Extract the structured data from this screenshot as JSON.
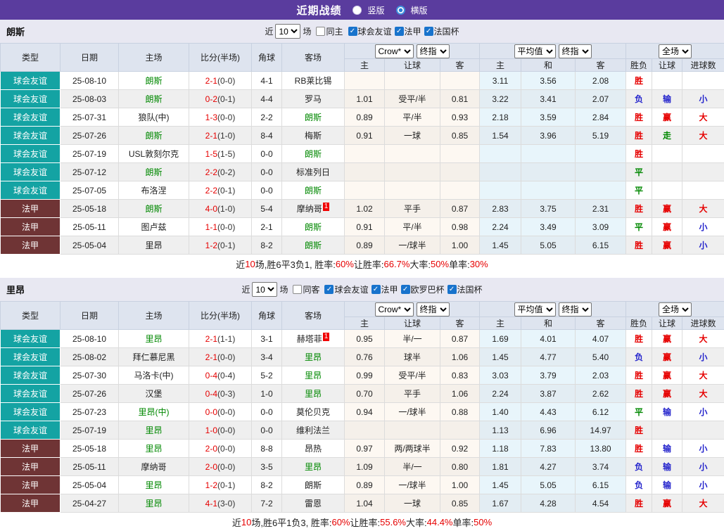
{
  "topbar": {
    "title": "近期战绩",
    "radios": [
      {
        "label": "竖版",
        "checked": false
      },
      {
        "label": "横版",
        "checked": true
      }
    ]
  },
  "table_header": {
    "cols": [
      "类型",
      "日期",
      "主场",
      "比分(半场)",
      "角球",
      "客场"
    ],
    "group1_selects": [
      "Crow*",
      "终指"
    ],
    "group2_selects": [
      "平均值",
      "终指"
    ],
    "group3_selects": [
      "全场"
    ],
    "sub_cols": [
      "主",
      "让球",
      "客",
      "主",
      "和",
      "客",
      "胜负",
      "让球",
      "进球数"
    ]
  },
  "colors": {
    "red": "#E60000",
    "green": "#008800",
    "blue": "#2424CC",
    "teal": "#14A3A3",
    "maroon": "#6F3435",
    "purple": "#5A3C9E"
  },
  "sections": [
    {
      "team": "朗斯",
      "filter": {
        "prefix": "近",
        "matches": "10",
        "suffix": "场",
        "same_label": "同主",
        "same_checked": false,
        "leagues": [
          {
            "label": "球会友谊",
            "checked": true
          },
          {
            "label": "法甲",
            "checked": true
          },
          {
            "label": "法国杯",
            "checked": true
          }
        ]
      },
      "rows": [
        {
          "league": "球会友谊",
          "kind": "f",
          "date": "25-08-10",
          "home": "朗斯",
          "home_green": 1,
          "home_badge": "",
          "score": "2-1",
          "half": "(0-0)",
          "corners": "4-1",
          "away": "RB莱比锡",
          "away_green": 0,
          "away_badge": "",
          "odds_home": "",
          "line": "",
          "odds_away": "",
          "avg_home": "3.11",
          "avg_draw": "3.56",
          "avg_away": "2.08",
          "wdl": [
            "胜",
            "r"
          ],
          "handicap_res": [
            "",
            ""
          ],
          "goals_res": [
            "",
            ""
          ]
        },
        {
          "league": "球会友谊",
          "kind": "f",
          "date": "25-08-03",
          "home": "朗斯",
          "home_green": 1,
          "home_badge": "",
          "score": "0-2",
          "half": "(0-1)",
          "corners": "4-4",
          "away": "罗马",
          "away_green": 0,
          "away_badge": "",
          "odds_home": "1.01",
          "line": "受平/半",
          "odds_away": "0.81",
          "avg_home": "3.22",
          "avg_draw": "3.41",
          "avg_away": "2.07",
          "wdl": [
            "负",
            "b"
          ],
          "handicap_res": [
            "输",
            "b"
          ],
          "goals_res": [
            "小",
            "b"
          ]
        },
        {
          "league": "球会友谊",
          "kind": "f",
          "date": "25-07-31",
          "home": "狼队(中)",
          "home_green": 0,
          "home_badge": "",
          "score": "1-3",
          "half": "(0-0)",
          "corners": "2-2",
          "away": "朗斯",
          "away_green": 1,
          "away_badge": "",
          "odds_home": "0.89",
          "line": "平/半",
          "odds_away": "0.93",
          "avg_home": "2.18",
          "avg_draw": "3.59",
          "avg_away": "2.84",
          "wdl": [
            "胜",
            "r"
          ],
          "handicap_res": [
            "赢",
            "r"
          ],
          "goals_res": [
            "大",
            "r"
          ]
        },
        {
          "league": "球会友谊",
          "kind": "f",
          "date": "25-07-26",
          "home": "朗斯",
          "home_green": 1,
          "home_badge": "",
          "score": "2-1",
          "half": "(1-0)",
          "corners": "8-4",
          "away": "梅斯",
          "away_green": 0,
          "away_badge": "",
          "odds_home": "0.91",
          "line": "一球",
          "odds_away": "0.85",
          "avg_home": "1.54",
          "avg_draw": "3.96",
          "avg_away": "5.19",
          "wdl": [
            "胜",
            "r"
          ],
          "handicap_res": [
            "走",
            "g"
          ],
          "goals_res": [
            "大",
            "r"
          ]
        },
        {
          "league": "球会友谊",
          "kind": "f",
          "date": "25-07-19",
          "home": "USL敦刻尔克",
          "home_green": 0,
          "home_badge": "",
          "score": "1-5",
          "half": "(1-5)",
          "corners": "0-0",
          "away": "朗斯",
          "away_green": 1,
          "away_badge": "",
          "odds_home": "",
          "line": "",
          "odds_away": "",
          "avg_home": "",
          "avg_draw": "",
          "avg_away": "",
          "wdl": [
            "胜",
            "r"
          ],
          "handicap_res": [
            "",
            ""
          ],
          "goals_res": [
            "",
            ""
          ]
        },
        {
          "league": "球会友谊",
          "kind": "f",
          "date": "25-07-12",
          "home": "朗斯",
          "home_green": 1,
          "home_badge": "",
          "score": "2-2",
          "half": "(0-2)",
          "corners": "0-0",
          "away": "标准列日",
          "away_green": 0,
          "away_badge": "",
          "odds_home": "",
          "line": "",
          "odds_away": "",
          "avg_home": "",
          "avg_draw": "",
          "avg_away": "",
          "wdl": [
            "平",
            "g"
          ],
          "handicap_res": [
            "",
            ""
          ],
          "goals_res": [
            "",
            ""
          ]
        },
        {
          "league": "球会友谊",
          "kind": "f",
          "date": "25-07-05",
          "home": "布洛涅",
          "home_green": 0,
          "home_badge": "",
          "score": "2-2",
          "half": "(0-1)",
          "corners": "0-0",
          "away": "朗斯",
          "away_green": 1,
          "away_badge": "",
          "odds_home": "",
          "line": "",
          "odds_away": "",
          "avg_home": "",
          "avg_draw": "",
          "avg_away": "",
          "wdl": [
            "平",
            "g"
          ],
          "handicap_res": [
            "",
            ""
          ],
          "goals_res": [
            "",
            ""
          ]
        },
        {
          "league": "法甲",
          "kind": "l",
          "date": "25-05-18",
          "home": "朗斯",
          "home_green": 1,
          "home_badge": "",
          "score": "4-0",
          "half": "(1-0)",
          "corners": "5-4",
          "away": "摩纳哥",
          "away_green": 0,
          "away_badge": "1",
          "odds_home": "1.02",
          "line": "平手",
          "odds_away": "0.87",
          "avg_home": "2.83",
          "avg_draw": "3.75",
          "avg_away": "2.31",
          "wdl": [
            "胜",
            "r"
          ],
          "handicap_res": [
            "赢",
            "r"
          ],
          "goals_res": [
            "大",
            "r"
          ]
        },
        {
          "league": "法甲",
          "kind": "l",
          "date": "25-05-11",
          "home": "图卢兹",
          "home_green": 0,
          "home_badge": "",
          "score": "1-1",
          "half": "(0-0)",
          "corners": "2-1",
          "away": "朗斯",
          "away_green": 1,
          "away_badge": "",
          "odds_home": "0.91",
          "line": "平/半",
          "odds_away": "0.98",
          "avg_home": "2.24",
          "avg_draw": "3.49",
          "avg_away": "3.09",
          "wdl": [
            "平",
            "g"
          ],
          "handicap_res": [
            "赢",
            "r"
          ],
          "goals_res": [
            "小",
            "b"
          ]
        },
        {
          "league": "法甲",
          "kind": "l",
          "date": "25-05-04",
          "home": "里昂",
          "home_green": 0,
          "home_badge": "",
          "score": "1-2",
          "half": "(0-1)",
          "corners": "8-2",
          "away": "朗斯",
          "away_green": 1,
          "away_badge": "",
          "odds_home": "0.89",
          "line": "一/球半",
          "odds_away": "1.00",
          "avg_home": "1.45",
          "avg_draw": "5.05",
          "avg_away": "6.15",
          "wdl": [
            "胜",
            "r"
          ],
          "handicap_res": [
            "赢",
            "r"
          ],
          "goals_res": [
            "小",
            "b"
          ]
        }
      ],
      "summary": [
        {
          "t": "近",
          "red": false
        },
        {
          "t": "10",
          "red": true
        },
        {
          "t": "场,胜6平3负1, 胜率:",
          "red": false
        },
        {
          "t": "60%",
          "red": true
        },
        {
          "t": " 让胜率:",
          "red": false
        },
        {
          "t": "66.7%",
          "red": true
        },
        {
          "t": " 大率:",
          "red": false
        },
        {
          "t": "50%",
          "red": true
        },
        {
          "t": " 单率:",
          "red": false
        },
        {
          "t": "30%",
          "red": true
        }
      ]
    },
    {
      "team": "里昂",
      "filter": {
        "prefix": "近",
        "matches": "10",
        "suffix": "场",
        "same_label": "同客",
        "same_checked": false,
        "leagues": [
          {
            "label": "球会友谊",
            "checked": true
          },
          {
            "label": "法甲",
            "checked": true
          },
          {
            "label": "欧罗巴杯",
            "checked": true
          },
          {
            "label": "法国杯",
            "checked": true
          }
        ]
      },
      "rows": [
        {
          "league": "球会友谊",
          "kind": "f",
          "date": "25-08-10",
          "home": "里昂",
          "home_green": 1,
          "home_badge": "",
          "score": "2-1",
          "half": "(1-1)",
          "corners": "3-1",
          "away": "赫塔菲",
          "away_green": 0,
          "away_badge": "1",
          "odds_home": "0.95",
          "line": "半/一",
          "odds_away": "0.87",
          "avg_home": "1.69",
          "avg_draw": "4.01",
          "avg_away": "4.07",
          "wdl": [
            "胜",
            "r"
          ],
          "handicap_res": [
            "赢",
            "r"
          ],
          "goals_res": [
            "大",
            "r"
          ]
        },
        {
          "league": "球会友谊",
          "kind": "f",
          "date": "25-08-02",
          "home": "拜仁慕尼黑",
          "home_green": 0,
          "home_badge": "",
          "score": "2-1",
          "half": "(0-0)",
          "corners": "3-4",
          "away": "里昂",
          "away_green": 1,
          "away_badge": "",
          "odds_home": "0.76",
          "line": "球半",
          "odds_away": "1.06",
          "avg_home": "1.45",
          "avg_draw": "4.77",
          "avg_away": "5.40",
          "wdl": [
            "负",
            "b"
          ],
          "handicap_res": [
            "赢",
            "r"
          ],
          "goals_res": [
            "小",
            "b"
          ]
        },
        {
          "league": "球会友谊",
          "kind": "f",
          "date": "25-07-30",
          "home": "马洛卡(中)",
          "home_green": 0,
          "home_badge": "",
          "score": "0-4",
          "half": "(0-4)",
          "corners": "5-2",
          "away": "里昂",
          "away_green": 1,
          "away_badge": "",
          "odds_home": "0.99",
          "line": "受平/半",
          "odds_away": "0.83",
          "avg_home": "3.03",
          "avg_draw": "3.79",
          "avg_away": "2.03",
          "wdl": [
            "胜",
            "r"
          ],
          "handicap_res": [
            "赢",
            "r"
          ],
          "goals_res": [
            "大",
            "r"
          ]
        },
        {
          "league": "球会友谊",
          "kind": "f",
          "date": "25-07-26",
          "home": "汉堡",
          "home_green": 0,
          "home_badge": "",
          "score": "0-4",
          "half": "(0-3)",
          "corners": "1-0",
          "away": "里昂",
          "away_green": 1,
          "away_badge": "",
          "odds_home": "0.70",
          "line": "平手",
          "odds_away": "1.06",
          "avg_home": "2.24",
          "avg_draw": "3.87",
          "avg_away": "2.62",
          "wdl": [
            "胜",
            "r"
          ],
          "handicap_res": [
            "赢",
            "r"
          ],
          "goals_res": [
            "大",
            "r"
          ]
        },
        {
          "league": "球会友谊",
          "kind": "f",
          "date": "25-07-23",
          "home": "里昂(中)",
          "home_green": 1,
          "home_badge": "",
          "score": "0-0",
          "half": "(0-0)",
          "corners": "0-0",
          "away": "莫伦贝克",
          "away_green": 0,
          "away_badge": "",
          "odds_home": "0.94",
          "line": "一/球半",
          "odds_away": "0.88",
          "avg_home": "1.40",
          "avg_draw": "4.43",
          "avg_away": "6.12",
          "wdl": [
            "平",
            "g"
          ],
          "handicap_res": [
            "输",
            "b"
          ],
          "goals_res": [
            "小",
            "b"
          ]
        },
        {
          "league": "球会友谊",
          "kind": "f",
          "date": "25-07-19",
          "home": "里昂",
          "home_green": 1,
          "home_badge": "",
          "score": "1-0",
          "half": "(0-0)",
          "corners": "0-0",
          "away": "维利法兰",
          "away_green": 0,
          "away_badge": "",
          "odds_home": "",
          "line": "",
          "odds_away": "",
          "avg_home": "1.13",
          "avg_draw": "6.96",
          "avg_away": "14.97",
          "wdl": [
            "胜",
            "r"
          ],
          "handicap_res": [
            "",
            ""
          ],
          "goals_res": [
            "",
            ""
          ]
        },
        {
          "league": "法甲",
          "kind": "l",
          "date": "25-05-18",
          "home": "里昂",
          "home_green": 1,
          "home_badge": "",
          "score": "2-0",
          "half": "(0-0)",
          "corners": "8-8",
          "away": "昂热",
          "away_green": 0,
          "away_badge": "",
          "odds_home": "0.97",
          "line": "两/两球半",
          "odds_away": "0.92",
          "avg_home": "1.18",
          "avg_draw": "7.83",
          "avg_away": "13.80",
          "wdl": [
            "胜",
            "r"
          ],
          "handicap_res": [
            "输",
            "b"
          ],
          "goals_res": [
            "小",
            "b"
          ]
        },
        {
          "league": "法甲",
          "kind": "l",
          "date": "25-05-11",
          "home": "摩纳哥",
          "home_green": 0,
          "home_badge": "",
          "score": "2-0",
          "half": "(0-0)",
          "corners": "3-5",
          "away": "里昂",
          "away_green": 1,
          "away_badge": "",
          "odds_home": "1.09",
          "line": "半/一",
          "odds_away": "0.80",
          "avg_home": "1.81",
          "avg_draw": "4.27",
          "avg_away": "3.74",
          "wdl": [
            "负",
            "b"
          ],
          "handicap_res": [
            "输",
            "b"
          ],
          "goals_res": [
            "小",
            "b"
          ]
        },
        {
          "league": "法甲",
          "kind": "l",
          "date": "25-05-04",
          "home": "里昂",
          "home_green": 1,
          "home_badge": "",
          "score": "1-2",
          "half": "(0-1)",
          "corners": "8-2",
          "away": "朗斯",
          "away_green": 0,
          "away_badge": "",
          "odds_home": "0.89",
          "line": "一/球半",
          "odds_away": "1.00",
          "avg_home": "1.45",
          "avg_draw": "5.05",
          "avg_away": "6.15",
          "wdl": [
            "负",
            "b"
          ],
          "handicap_res": [
            "输",
            "b"
          ],
          "goals_res": [
            "小",
            "b"
          ]
        },
        {
          "league": "法甲",
          "kind": "l",
          "date": "25-04-27",
          "home": "里昂",
          "home_green": 1,
          "home_badge": "",
          "score": "4-1",
          "half": "(3-0)",
          "corners": "7-2",
          "away": "雷恩",
          "away_green": 0,
          "away_badge": "",
          "odds_home": "1.04",
          "line": "一球",
          "odds_away": "0.85",
          "avg_home": "1.67",
          "avg_draw": "4.28",
          "avg_away": "4.54",
          "wdl": [
            "胜",
            "r"
          ],
          "handicap_res": [
            "赢",
            "r"
          ],
          "goals_res": [
            "大",
            "r"
          ]
        }
      ],
      "summary": [
        {
          "t": "近",
          "red": false
        },
        {
          "t": "10",
          "red": true
        },
        {
          "t": "场,胜6平1负3, 胜率:",
          "red": false
        },
        {
          "t": "60%",
          "red": true
        },
        {
          "t": " 让胜率:",
          "red": false
        },
        {
          "t": "55.6%",
          "red": true
        },
        {
          "t": " 大率:",
          "red": false
        },
        {
          "t": "44.4%",
          "red": true
        },
        {
          "t": " 单率:",
          "red": false
        },
        {
          "t": "50%",
          "red": true
        }
      ]
    }
  ]
}
